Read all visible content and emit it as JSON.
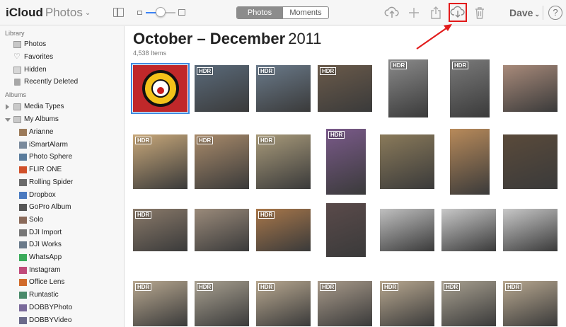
{
  "app": {
    "name_bold": "iCloud",
    "name_light": "Photos"
  },
  "segment": {
    "photos": "Photos",
    "moments": "Moments"
  },
  "user": {
    "name": "Dave"
  },
  "help": {
    "label": "?"
  },
  "toolbar_icons": [
    "upload-icon",
    "add-icon",
    "share-icon",
    "download-icon",
    "trash-icon"
  ],
  "accent_color": "#3f8ae0",
  "highlight_color": "#e21a1a",
  "sidebar": {
    "library_title": "Library",
    "library": [
      {
        "label": "Photos",
        "icon": "photos-icon"
      },
      {
        "label": "Favorites",
        "icon": "heart-icon"
      },
      {
        "label": "Hidden",
        "icon": "hidden-icon"
      },
      {
        "label": "Recently Deleted",
        "icon": "trash-icon"
      }
    ],
    "albums_title": "Albums",
    "groups": [
      {
        "label": "Media Types",
        "expanded": false
      },
      {
        "label": "My Albums",
        "expanded": true
      }
    ],
    "albums": [
      "Arianne",
      "iSmartAlarm",
      "Photo Sphere",
      "FLIR ONE",
      "Rolling Spider",
      "Dropbox",
      "GoPro Album",
      "Solo",
      "DJI Import",
      "DJI Works",
      "WhatsApp",
      "Instagram",
      "Office Lens",
      "Runtastic",
      "DOBBYPhoto",
      "DOBBYVideo"
    ]
  },
  "main": {
    "title_range": "October – December",
    "title_year": "2011",
    "count": "4,538 Items",
    "badge": "HDR"
  }
}
